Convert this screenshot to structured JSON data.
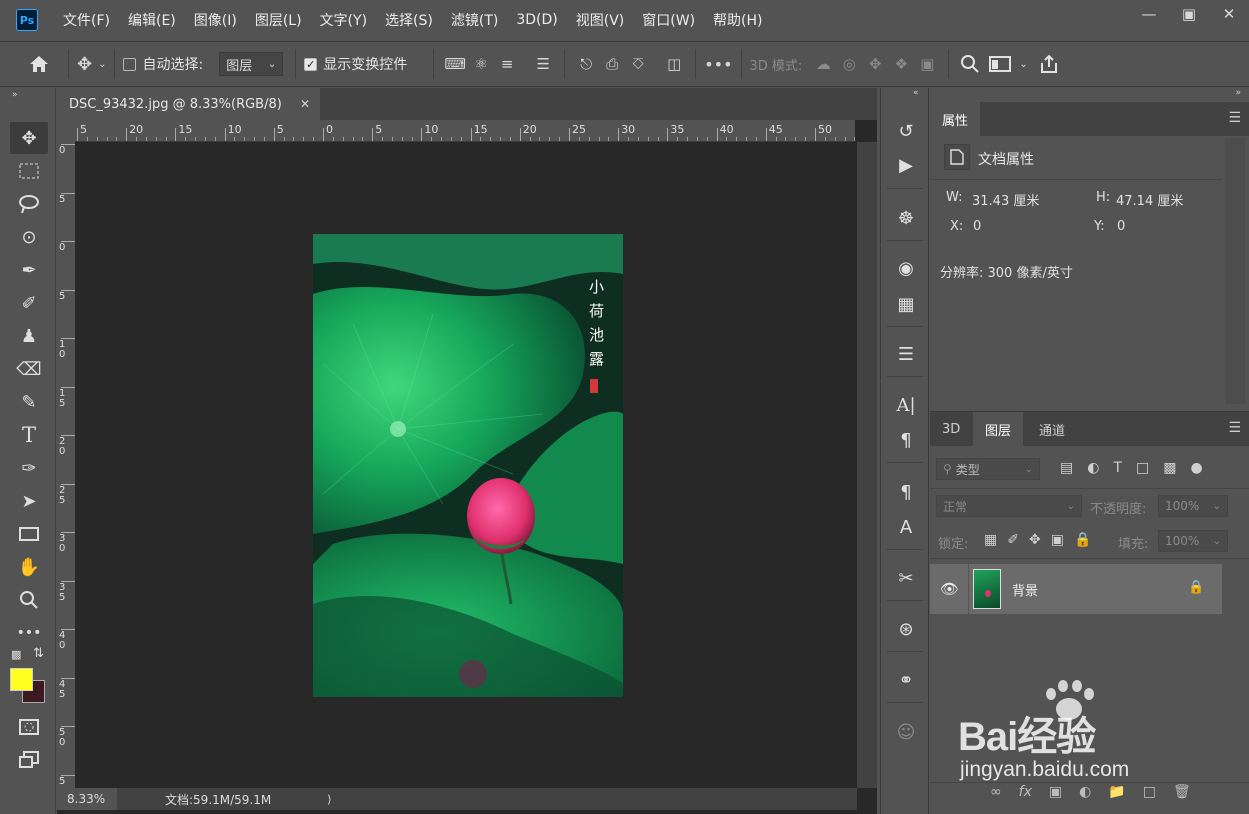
{
  "app": {
    "logo": "Ps"
  },
  "menu": [
    "文件(F)",
    "编辑(E)",
    "图像(I)",
    "图层(L)",
    "文字(Y)",
    "选择(S)",
    "滤镜(T)",
    "3D(D)",
    "视图(V)",
    "窗口(W)",
    "帮助(H)"
  ],
  "options": {
    "auto_select_label": "自动选择:",
    "auto_select_value": "图层",
    "show_transform_label": "显示变换控件",
    "mode_3d_label": "3D 模式:",
    "more": "•••"
  },
  "document": {
    "tab_title": "DSC_93432.jpg @ 8.33%(RGB/8)",
    "zoom": "8.33%",
    "doc_size": "文档:59.1M/59.1M",
    "poem": [
      "小",
      "荷",
      "池",
      "露"
    ],
    "hruler_labels": [
      "5",
      "20",
      "15",
      "10",
      "5",
      "0",
      "5",
      "10",
      "15",
      "20",
      "25",
      "30",
      "35",
      "40",
      "45",
      "50"
    ],
    "vruler_labels": [
      "0",
      "5",
      "0",
      "5",
      "1 0",
      "1 5",
      "2 0",
      "2 5",
      "3 0",
      "3 5",
      "4 0",
      "4 5",
      "5 0",
      "5"
    ]
  },
  "properties": {
    "tab": "属性",
    "section": "文档属性",
    "w_label": "W:",
    "w_value": "31.43 厘米",
    "h_label": "H:",
    "h_value": "47.14 厘米",
    "x_label": "X:",
    "x_value": "0",
    "y_label": "Y:",
    "y_value": "0",
    "resolution": "分辨率: 300 像素/英寸"
  },
  "layers_panel": {
    "tabs": [
      "3D",
      "图层",
      "通道"
    ],
    "filter_placeholder": "类型",
    "blend_mode": "正常",
    "opacity_label": "不透明度:",
    "opacity_value": "100%",
    "lock_label": "锁定:",
    "fill_label": "填充:",
    "fill_value": "100%",
    "layer_name": "背景"
  },
  "watermark": {
    "brand": "Bai经验",
    "url": "jingyan.baidu.com"
  },
  "colors": {
    "foreground": "#ffff22",
    "background": "#3a1a20",
    "ui_bg": "#535353",
    "canvas_bg": "#282828"
  }
}
